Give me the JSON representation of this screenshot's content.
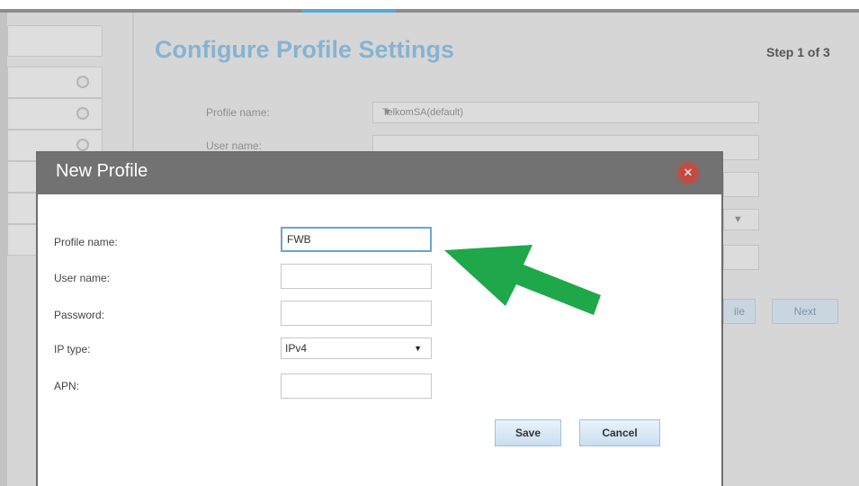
{
  "page": {
    "title": "Configure Profile Settings",
    "step": "Step 1 of 3"
  },
  "background_form": {
    "profile_name_label": "Profile name:",
    "profile_name_value": "TelkomSA(default)",
    "user_name_label": "User name:",
    "buttons": {
      "partial_label": "ile",
      "next": "Next"
    }
  },
  "modal": {
    "title": "New Profile",
    "fields": {
      "profile_name": {
        "label": "Profile name:",
        "value": "FWB"
      },
      "user_name": {
        "label": "User name:",
        "value": ""
      },
      "password": {
        "label": "Password:",
        "value": ""
      },
      "ip_type": {
        "label": "IP type:",
        "value": "IPv4"
      },
      "apn": {
        "label": "APN:",
        "value": ""
      }
    },
    "buttons": {
      "save": "Save",
      "cancel": "Cancel"
    }
  },
  "colors": {
    "title_blue": "#86b3d2",
    "modal_header": "#727272",
    "close_red": "#c64a42",
    "arrow_green": "#1fa84a"
  },
  "icons": {
    "modal_close": "close-icon",
    "select_caret": "chevron-down-icon",
    "cursor": "mouse-pointer-icon",
    "annotation": "green-arrow-icon"
  }
}
